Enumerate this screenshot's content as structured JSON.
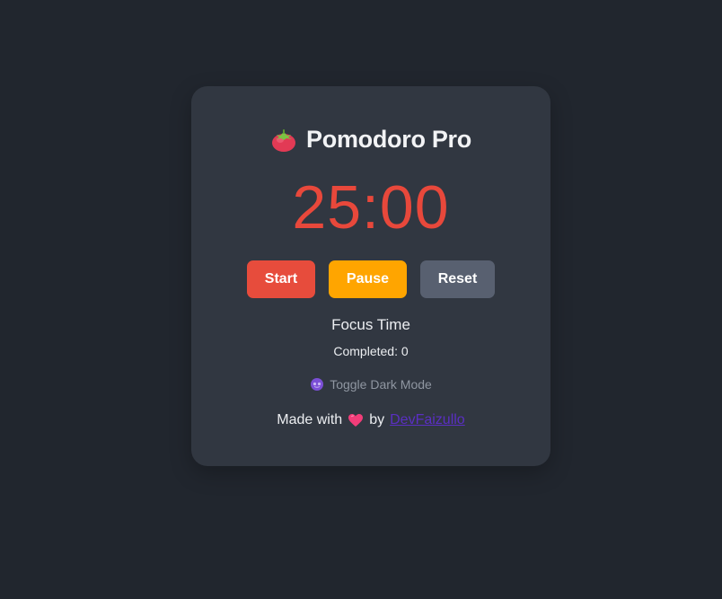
{
  "app": {
    "title": "Pomodoro Pro",
    "title_icon": "tomato-icon"
  },
  "timer": {
    "display": "25:00"
  },
  "controls": {
    "start_label": "Start",
    "pause_label": "Pause",
    "reset_label": "Reset"
  },
  "status": {
    "mode": "Focus Time",
    "completed_label": "Completed:",
    "completed_count": "0"
  },
  "toggle": {
    "label": "Toggle Dark Mode",
    "icon": "moon-icon"
  },
  "footer": {
    "made_with": "Made with",
    "heart_icon": "heart-icon",
    "by": "by",
    "author": "DevFaizullo"
  },
  "colors": {
    "background": "#21262e",
    "card": "#313741",
    "timer": "#e8483b",
    "start": "#e74c3c",
    "pause": "#ffa500",
    "reset": "#586070",
    "link": "#5a2fc2"
  }
}
